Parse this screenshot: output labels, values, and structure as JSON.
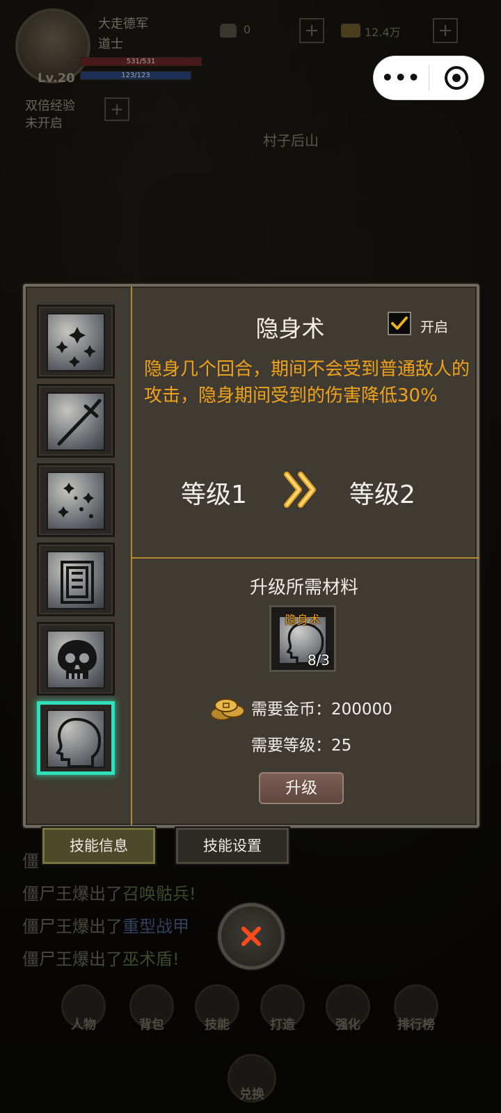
{
  "hud": {
    "player_name": "大走德军",
    "player_class": "道士",
    "hp_text": "531/531",
    "mp_text": "123/123",
    "level": "Lv.20",
    "double_exp_label": "双倍经验",
    "double_exp_state": "未开启",
    "ingot_count": "0",
    "gold_count": "12.4万",
    "location": "村子后山"
  },
  "dialog": {
    "skill_title": "隐身术",
    "enable_label": "开启",
    "enabled": true,
    "description": "隐身几个回合，期间不会受到普通敌人的攻击，隐身期间受到的伤害降低30%",
    "level_from": "等级1",
    "level_to": "等级2",
    "materials_title": "升级所需材料",
    "material_name": "隐身术",
    "material_count": "8/3",
    "gold_required": "需要金币：200000",
    "level_required": "需要等级：25",
    "upgrade_label": "升级",
    "skills": [
      {
        "icon": "stars-icon"
      },
      {
        "icon": "sword-icon"
      },
      {
        "icon": "sparkles-icon"
      },
      {
        "icon": "talisman-icon"
      },
      {
        "icon": "skull-icon"
      },
      {
        "icon": "head-silhouette-icon",
        "selected": true
      }
    ]
  },
  "tabs": {
    "info": "技能信息",
    "settings": "技能设置"
  },
  "log": [
    {
      "prefix": "僵",
      "item": ""
    },
    {
      "prefix": "僵尸王爆出了",
      "item": "召唤骷兵!"
    },
    {
      "prefix": "僵尸王爆出了",
      "item": "重型战甲"
    },
    {
      "prefix": "僵尸王爆出了",
      "item": "巫术盾!"
    }
  ],
  "nav": {
    "character": "人物",
    "bag": "背包",
    "skill": "技能",
    "forge": "打造",
    "enhance": "强化",
    "ranking": "排行榜",
    "exchange": "兑换"
  },
  "colors": {
    "accent_gold": "#b48b2a",
    "desc_orange": "#f0a21a",
    "selected_teal": "#2fe0b8",
    "close_x": "#ff4a1a"
  }
}
